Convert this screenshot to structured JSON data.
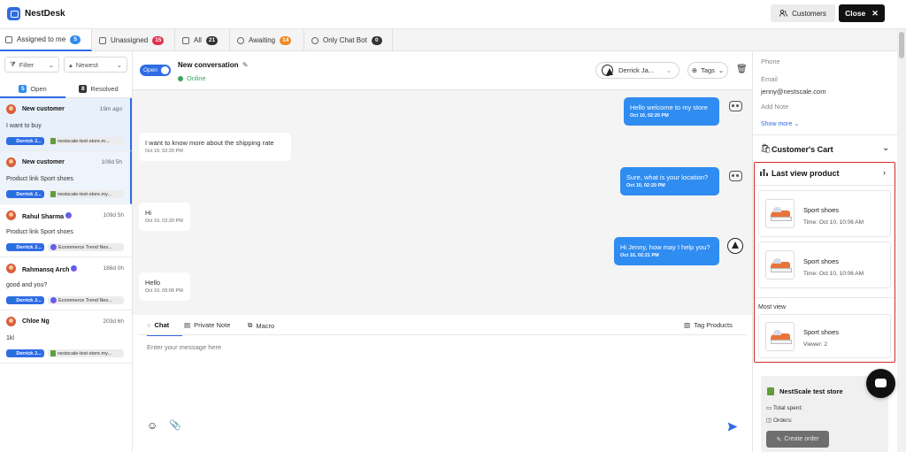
{
  "header": {
    "app_name": "NestDesk",
    "customers_label": "Customers",
    "close_label": "Close"
  },
  "tabs": [
    {
      "label": "Assigned to me",
      "count": "5",
      "color": "#2f8cf0"
    },
    {
      "label": "Unassigned",
      "count": "15",
      "color": "#e0304a"
    },
    {
      "label": "All",
      "count": "21",
      "color": "#333333"
    },
    {
      "label": "Awaiting",
      "count": "14",
      "color": "#f08a24"
    },
    {
      "label": "Only Chat Bot",
      "count": "0",
      "color": "#333333"
    }
  ],
  "left": {
    "filter_label": "Filter",
    "sort_label": "Newest",
    "open_count": "5",
    "open_label": "Open",
    "resolved_count": "8",
    "resolved_label": "Resolved",
    "conversations": [
      {
        "name": "New customer",
        "time": "19m ago",
        "message": "I want to buy",
        "agent": "Derrick J...",
        "store": "nestscale-test-store.m...",
        "channel": "shopify"
      },
      {
        "name": "New customer",
        "time": "109d 5h",
        "message": "Product link Sport shoes",
        "agent": "Derrick J...",
        "store": "nestscale-test-store.my...",
        "channel": "shopify"
      },
      {
        "name": "Rahul Sharma",
        "time": "109d 5h",
        "message": "Product link Sport shoes",
        "agent": "Derrick J...",
        "store": "Ecommerce Trend Nes...",
        "channel": "messenger"
      },
      {
        "name": "Rahmansq Arch",
        "time": "186d 0h",
        "message": "good and you?",
        "agent": "Derrick J...",
        "store": "Ecommerce Trend Nes...",
        "channel": "messenger"
      },
      {
        "name": "Chloe Ng",
        "time": "203d 6h",
        "message": "1kl",
        "agent": "Derrick J...",
        "store": "nestscale-test-store.my...",
        "channel": "shopify"
      }
    ]
  },
  "chat": {
    "toggle_label": "Open",
    "title": "New conversation",
    "status": "Online",
    "agent_select": "Derrick Ja...",
    "tags_label": "Tags",
    "messages": [
      {
        "dir": "out",
        "text": "Hello welcome to my store",
        "time": "Oct 10, 02:20 PM"
      },
      {
        "dir": "in",
        "text": "I want to know more about the shipping rate",
        "time": "Oct 10, 02:20 PM"
      },
      {
        "dir": "out",
        "text": "Sure, what is your location?",
        "time": "Oct 10, 02:20 PM"
      },
      {
        "dir": "in",
        "text": "Hi",
        "time": "Oct 10, 02:20 PM"
      },
      {
        "dir": "out",
        "text": "Hi Jenny, how may I help you?",
        "time": "Oct 10, 02:21 PM"
      },
      {
        "dir": "in",
        "text": "Hello",
        "time": "Oct 10, 05:06 PM"
      }
    ],
    "composer": {
      "tab_chat": "Chat",
      "tab_note": "Private Note",
      "tab_macro": "Macro",
      "tag_products": "Tag Products",
      "placeholder": "Enter your message here"
    }
  },
  "right": {
    "phone_label": "Phone",
    "email_label": "Email",
    "email_value": "jenny@nestscale.com",
    "note_label": "Add Note",
    "show_more": "Show more",
    "cart_title": "Customer's Cart",
    "last_view_title": "Last view product",
    "last_viewed": [
      {
        "name": "Sport shoes",
        "meta": "Time: Oct 10, 10:06 AM"
      },
      {
        "name": "Sport shoes",
        "meta": "Time: Oct 10, 10:06 AM"
      }
    ],
    "most_view_label": "Most view",
    "most_viewed": {
      "name": "Sport shoes",
      "meta": "Viewer: 2"
    },
    "store_name": "NestScale test store",
    "total_spent_label": "Total spent:",
    "orders_label": "Orders:",
    "create_order_label": "Create order"
  }
}
